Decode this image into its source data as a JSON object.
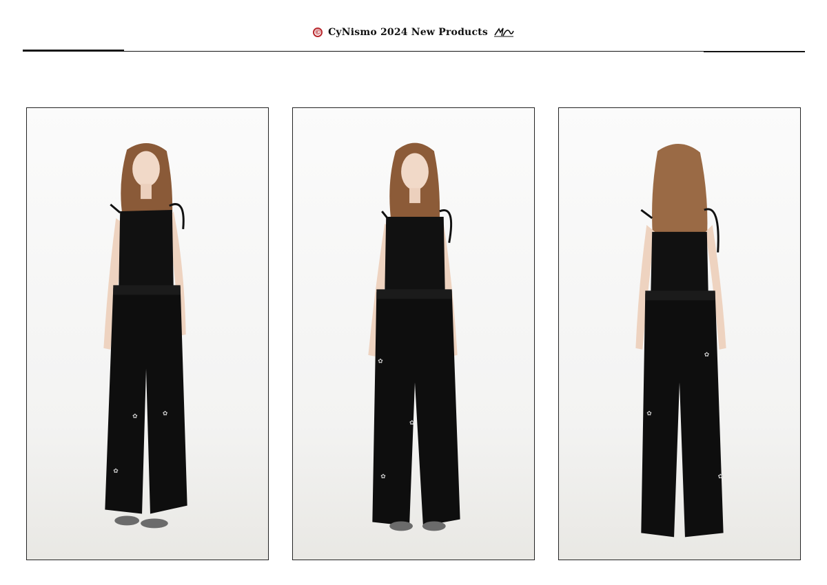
{
  "header": {
    "copyright_symbol": "©",
    "title": "CyNismo 2024 New Products",
    "brand_color": "#b8262b"
  },
  "gallery": [
    {
      "view": "front-three-quarter",
      "icon": "model-photo"
    },
    {
      "view": "front",
      "icon": "model-photo"
    },
    {
      "view": "back",
      "icon": "model-photo"
    }
  ]
}
